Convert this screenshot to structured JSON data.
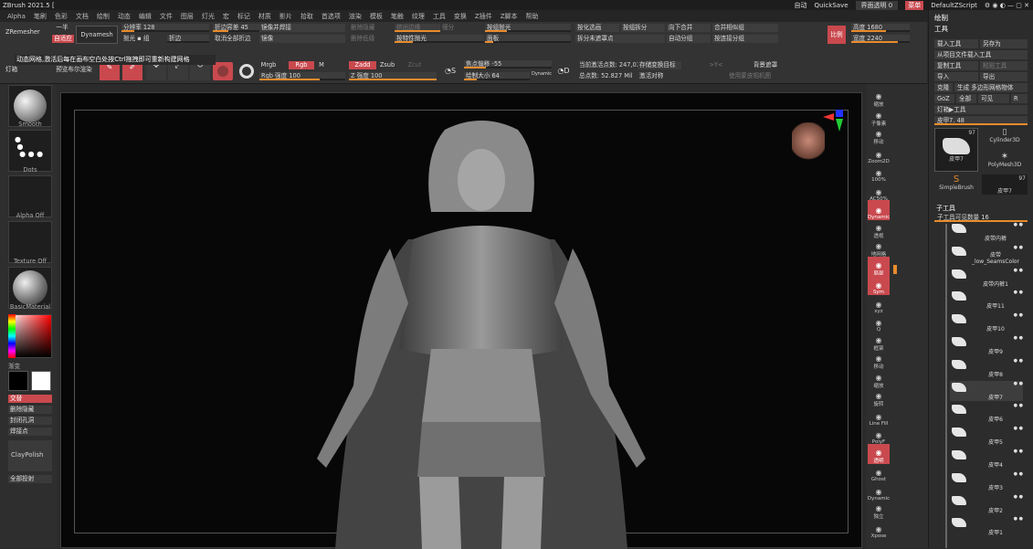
{
  "title_bar": {
    "app_title": "ZBrush 2021.5 [",
    "auto": "自动",
    "quicksave": "QuickSave",
    "interface_transparency": "界面透明 0",
    "menu_btn": "菜单",
    "script": "DefaultZScript"
  },
  "menu": [
    "Alpha",
    "笔刷",
    "色彩",
    "文档",
    "绘制",
    "动态",
    "编辑",
    "文件",
    "图层",
    "灯光",
    "宏",
    "标记",
    "材质",
    "影片",
    "拾取",
    "首选项",
    "渲染",
    "模板",
    "笔触",
    "纹理",
    "工具",
    "变换",
    "Z插件",
    "Z脚本",
    "帮助"
  ],
  "shelf": {
    "zremesher": "ZRemesher",
    "half": "一半",
    "adaptive": "自适应",
    "dynamesh": "Dynamesh",
    "resolution": "分辨率 128",
    "group": "组",
    "polish": "抛光",
    "blur": "折边",
    "fold_tolerance": "折边容差 45",
    "unfold_all": "取消全部折边",
    "mirror_weld": "镜像并焊接",
    "mirror": "镜像",
    "del_hidden": "删除隐藏",
    "del_lower": "删除低级",
    "extrude": "挤出边缘",
    "inflate": "边缘膨胀",
    "inner": "细分",
    "polish_fixed": "按特性抛光",
    "split_hidden": "拆分隐藏",
    "stretch": "合并拉伸",
    "polish_group": "按组抛光",
    "facet": "面板",
    "smooth_groups": "按组",
    "group_split": "按组拆分",
    "optimize": "按化选画",
    "split_unmasked": "拆分未遮罩点",
    "merge_down": "向下合并",
    "auto_group": "自动分组",
    "merge_similar": "合并相似组",
    "group_poly": "按连接分组",
    "mirror_vis": "比例",
    "height": "高度 1680",
    "width": "宽度 2240",
    "edit": "Edit",
    "move": "Move",
    "scale": "Scale",
    "rotate": "Rotate",
    "mrgb": "Mrgb",
    "rgb": "Rgb",
    "m": "M",
    "rgb_intensity": "Rgb 强度 100",
    "zadd": "Zadd",
    "zsub": "Zsub",
    "zcut": "Zcut",
    "z_intensity": "Z 强度 100",
    "focal_shift": "焦点偏移 -55",
    "draw_size": "绘制大小 64",
    "dynamic": "Dynamic",
    "active_points": "当前激活点数: 247,025",
    "total_points": "总点数: 52.827 Mil",
    "store_morph": "存储变换目标",
    "activate_sym": "激活对称",
    "xyz": ">Y<",
    "bg_remesh": "背景遮罩",
    "apply_morph": "使用蒙皮相机图",
    "lightbox": "灯箱",
    "preview": "预览布尔渲染"
  },
  "tooltip": "动态网格,激活后每在画布空白处按Ctrl拖拽即可重新构建网格",
  "left": {
    "smooth": "Smooth",
    "dots": "Dots",
    "alpha": "Alpha Off",
    "texture": "Texture Off",
    "material": "BasicMaterial",
    "gradient": "渐变",
    "switch": "交替",
    "del_hidden": "删除隐藏",
    "close_holes": "封闭孔洞",
    "weld": "焊接点",
    "claypolish": "ClayPolish",
    "project_all": "全部投射"
  },
  "rail": [
    "缩放",
    "子像素",
    "移动",
    "Zoom2D",
    "100%",
    "AC50%",
    "Dynamic",
    "透视",
    "地网格",
    "局部",
    "Sym",
    "xyz",
    "Q",
    "框架",
    "移动",
    "缩放",
    "旋转",
    "Line Fill",
    "PolyF",
    "透明",
    "Ghost",
    "Dynamic",
    "独立",
    "Xpose"
  ],
  "panel": {
    "brush_tab": "绘制",
    "tool_tab": "工具",
    "load": "载入工具",
    "save_as": "另存为",
    "load_from_project": "从项目文件载入工具",
    "copy": "复制工具",
    "paste": "粘贴工具",
    "import": "导入",
    "export": "导出",
    "clone": "克隆",
    "make_poly": "生成 多边形网格物体",
    "goz": "GoZ",
    "all": "全部",
    "visible": "可见",
    "r": "R",
    "lightbox_tools": "灯箱▶工具",
    "current_tool": "皮甲7. 48",
    "tool1": "皮甲7",
    "tool2": "Cylinder3D",
    "tool3": "PolyMesh3D",
    "tool4": "SimpleBrush",
    "tool5": "皮甲7",
    "tool1_count": "97",
    "tool5_count": "97",
    "subtool_title": "子工具",
    "subtool_count": "子工具可见数量 16"
  },
  "subtools": [
    "皮带内裤",
    "皮带_low_SeamsColor",
    "皮带内裤1",
    "皮甲11",
    "皮甲10",
    "皮甲9",
    "皮甲8",
    "皮甲7",
    "皮甲6",
    "皮甲5",
    "皮甲4",
    "皮甲3",
    "皮甲2",
    "皮甲1"
  ]
}
